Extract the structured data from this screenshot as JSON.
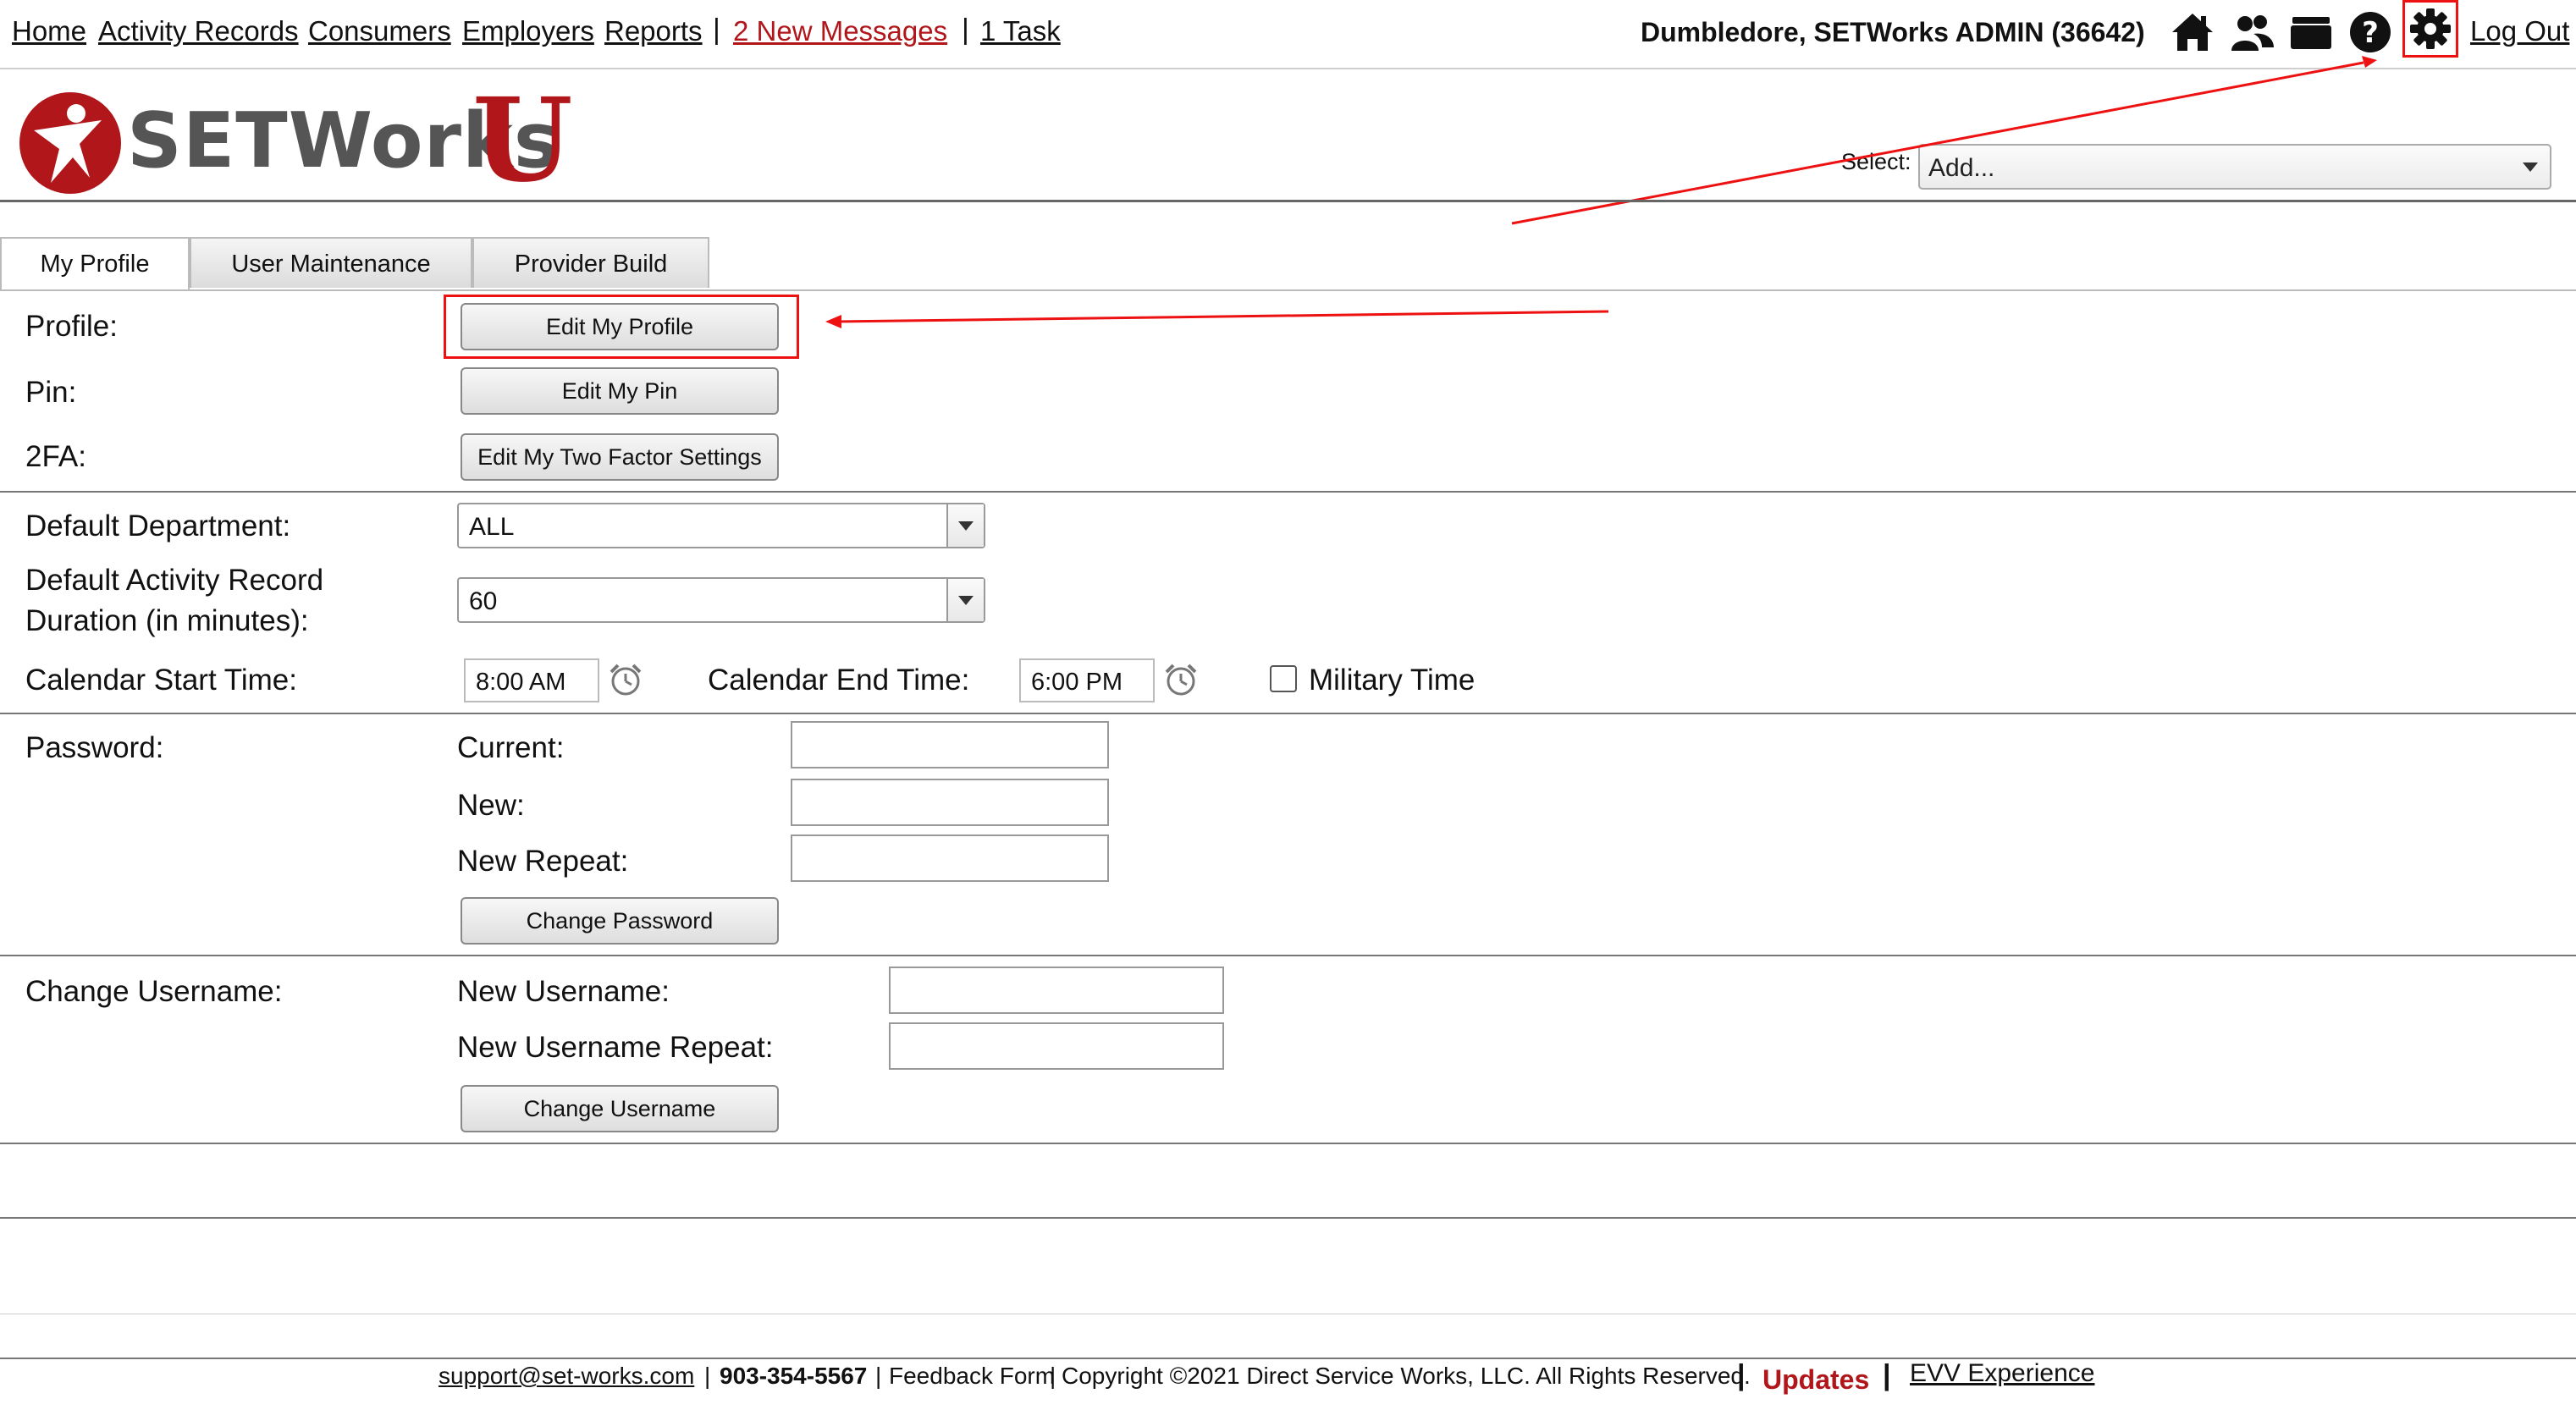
{
  "nav": {
    "links": [
      "Home",
      "Activity Records",
      "Consumers",
      "Employers",
      "Reports"
    ],
    "messages": "2 New Messages",
    "tasks": "1 Task",
    "user": "Dumbledore, SETWorks ADMIN  (36642)",
    "logout": "Log Out"
  },
  "logo": {
    "text": "SETWorks",
    "mark": "U"
  },
  "select": {
    "label": "Select:",
    "value": "Add..."
  },
  "tabs": [
    "My Profile",
    "User Maintenance",
    "Provider Build"
  ],
  "profile": {
    "profile_label": "Profile:",
    "edit_profile": "Edit My Profile",
    "pin_label": "Pin:",
    "edit_pin": "Edit My Pin",
    "twofa_label": "2FA:",
    "edit_twofa": "Edit My Two Factor Settings"
  },
  "defaults": {
    "dept_label": "Default Department:",
    "dept_value": "ALL",
    "duration_label_1": "Default Activity Record",
    "duration_label_2": "Duration (in minutes):",
    "duration_value": "60",
    "cal_start_label": "Calendar Start Time:",
    "cal_start_value": "8:00 AM",
    "cal_end_label": "Calendar End Time:",
    "cal_end_value": "6:00 PM",
    "military": "Military Time"
  },
  "password": {
    "label": "Password:",
    "current": "Current:",
    "new": "New:",
    "repeat": "New Repeat:",
    "button": "Change Password"
  },
  "username": {
    "label": "Change Username:",
    "new": "New Username:",
    "repeat": "New Username Repeat:",
    "button": "Change Username"
  },
  "footer": {
    "email": "support@set-works.com",
    "phone": "903-354-5567",
    "feedback": "Feedback Form",
    "copyright": "Copyright ©2021 Direct Service Works, LLC. All Rights Reserved.",
    "updates": "Updates",
    "evv": "EVV Experience"
  },
  "colors": {
    "brand_red": "#b0161a",
    "annotation_red": "#e11111"
  }
}
